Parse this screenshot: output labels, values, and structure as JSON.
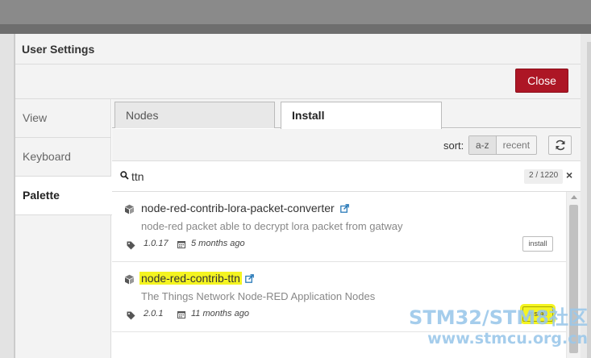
{
  "dialog": {
    "title": "User Settings",
    "close_label": "Close",
    "colors": {
      "close_bg": "#ad1625",
      "highlight": "#f4f421"
    }
  },
  "sidebar": {
    "items": [
      {
        "label": "View"
      },
      {
        "label": "Keyboard"
      },
      {
        "label": "Palette",
        "active": true
      }
    ]
  },
  "tabs": {
    "items": [
      {
        "label": "Nodes"
      },
      {
        "label": "Install",
        "active": true
      }
    ]
  },
  "sort": {
    "label": "sort:",
    "options": [
      {
        "label": "a-z",
        "selected": true
      },
      {
        "label": "recent"
      }
    ],
    "refresh_icon": "refresh-icon"
  },
  "search": {
    "value": "ttn",
    "count": "2 / 1220",
    "icon": "search-icon",
    "clear": "×"
  },
  "packages": [
    {
      "name": "node-red-contrib-lora-packet-converter",
      "description": "node-red packet able to decrypt lora packet from gatway",
      "version": "1.0.17",
      "updated": "5 months ago",
      "install_label": "install",
      "highlighted": false
    },
    {
      "name": "node-red-contrib-ttn",
      "description": "The Things Network Node-RED Application Nodes",
      "version": "2.0.1",
      "updated": "11 months ago",
      "install_label": "install",
      "highlighted": true
    }
  ],
  "watermark": {
    "line1": "STM32/STM8社区",
    "line2": "www.stmcu.org.cn"
  }
}
